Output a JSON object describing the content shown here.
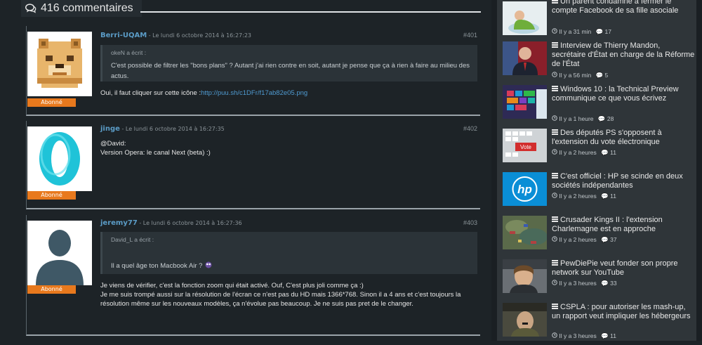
{
  "comments_header": {
    "icon": "comments-icon",
    "title": "416 commentaires"
  },
  "comments": [
    {
      "author": "Berri-UQAM",
      "date": " - Le lundi 6 octobre 2014 à 16:27:23",
      "number": "#401",
      "badge": "Abonné",
      "avatar": "pixel-dog-avatar",
      "quote_author": "okeN a écrit :",
      "quote_text": "C'est possible de filtrer les \"bons plans\" ? Autant j'ai rien contre en soit, autant je pense que ça à rien à faire au milieu des actus.",
      "text_prefix": "Oui, il faut cliquer sur cette icône :",
      "link": "http://puu.sh/c1DFr/f17ab82e05.png"
    },
    {
      "author": "jinge",
      "date": " - Le lundi 6 octobre 2014 à 16:27:35",
      "number": "#402",
      "badge": "Abonné",
      "avatar": "opera-logo-avatar",
      "line1": "@David:",
      "line2": "Version Opera: le canal Next (beta) :)"
    },
    {
      "author": "jeremy77",
      "date": " - Le lundi 6 octobre 2014 à 16:27:36",
      "number": "#403",
      "badge": "Abonné",
      "avatar": "default-user-avatar",
      "quote_author": "David_L a écrit :",
      "quote_text": "Il a quel âge ton Macbook Air ?",
      "line1": "Je viens de vérifier, c'est la fonction zoom qui était activé. Ouf, C'est plus joli comme ça :)",
      "line2": "Je me suis trompé aussi sur la résolution de l'écran ce n'est pas du HD mais 1366*768. Sinon il a 4 ans et c'est toujours la résolution  même sur les nouveaux modèles, ça n'évolue pas beaucoup. Je ne suis pas pret de le changer."
    }
  ],
  "sidebar": {
    "news": [
      {
        "title": "Un parent condamné à fermer le compte Facebook de sa fille asociale",
        "time": "Il y a 31 min",
        "count": "17"
      },
      {
        "title": "Interview de Thierry Mandon, secrétaire d'État en charge de la Réforme de l'État",
        "time": "Il y a 56 min",
        "count": "5"
      },
      {
        "title": "Windows 10 : la Technical Preview communique ce que vous écrivez",
        "time": "Il y a 1 heure",
        "count": "28"
      },
      {
        "title": "Des députés PS s'opposent à l'extension du vote électronique",
        "time": "Il y a 2 heures",
        "count": "11",
        "thumb_text": "Vote"
      },
      {
        "title": "C'est officiel : HP se scinde en deux sociétés indépendantes",
        "time": "Il y a 2 heures",
        "count": "11",
        "thumb_text": "hp"
      },
      {
        "title": "Crusader Kings II : l'extension Charlemagne est en approche",
        "time": "Il y a 2 heures",
        "count": "37"
      },
      {
        "title": "PewDiePie veut fonder son propre network sur YouTube",
        "time": "Il y a 3 heures",
        "count": "33"
      },
      {
        "title": "CSPLA : pour autoriser les mash-up, un rapport veut impliquer les hébergeurs",
        "time": "Il y a 3 heures",
        "count": "11"
      }
    ]
  }
}
